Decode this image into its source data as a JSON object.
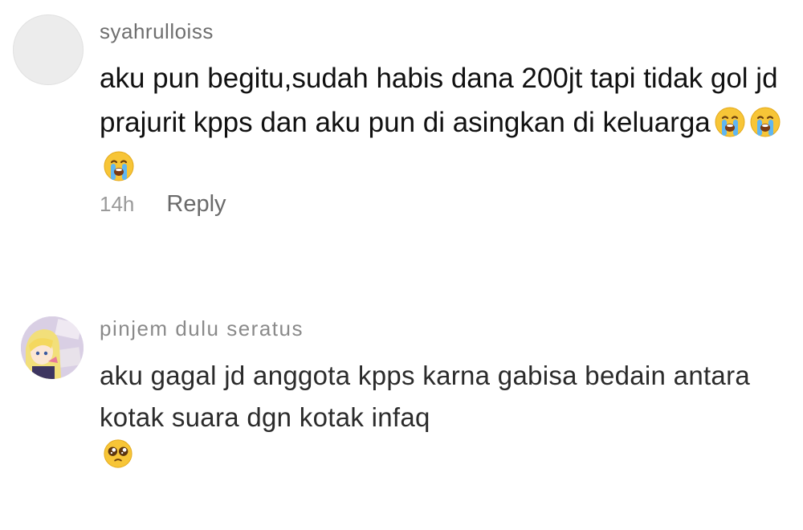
{
  "comments": [
    {
      "username": "syahrulloiss",
      "text": "aku pun begitu,sudah habis dana 200jt tapi tidak gol jd prajurit kpps dan aku pun di asingkan di keluarga",
      "emojis": [
        "loudly-crying-face",
        "loudly-crying-face",
        "loudly-crying-face"
      ],
      "timestamp": "14h",
      "reply_label": "Reply"
    },
    {
      "username": "pinjem dulu seratus",
      "text": "aku gagal jd anggota kpps karna gabisa bedain antara kotak suara dgn kotak infaq",
      "emojis": [
        "pleading-face"
      ]
    }
  ]
}
